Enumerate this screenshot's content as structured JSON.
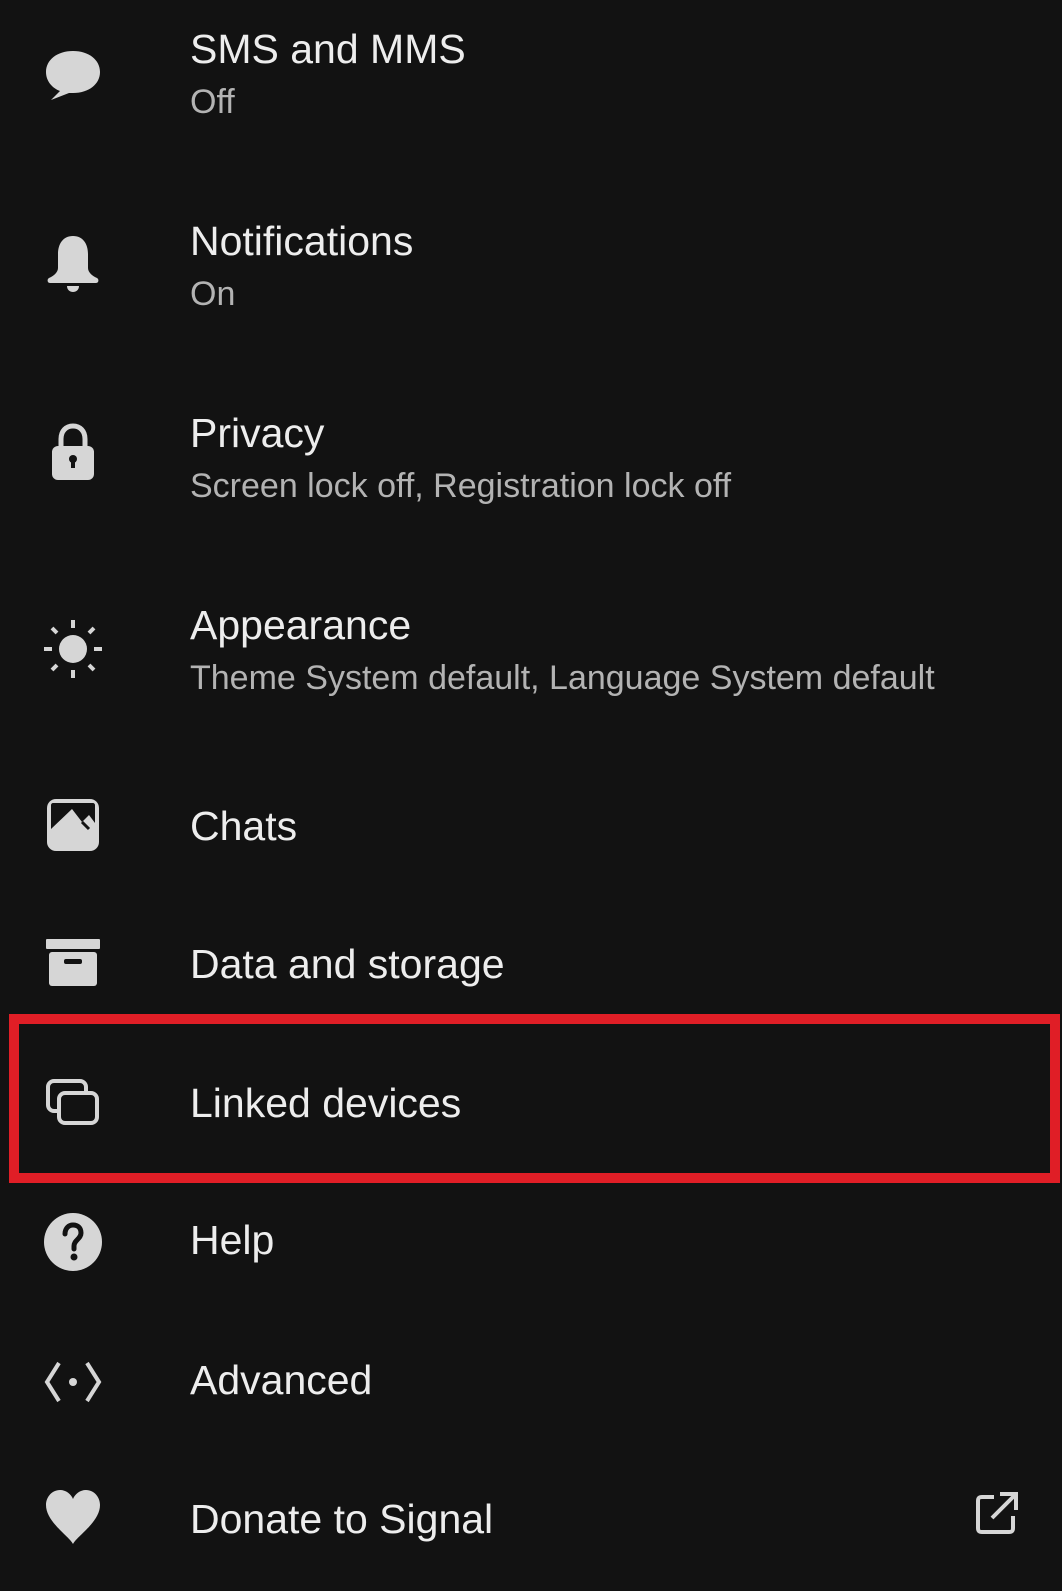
{
  "settings": {
    "items": [
      {
        "id": "sms-mms",
        "icon": "chat-bubble-icon",
        "title": "SMS and MMS",
        "subtitle": "Off"
      },
      {
        "id": "notifications",
        "icon": "bell-icon",
        "title": "Notifications",
        "subtitle": "On"
      },
      {
        "id": "privacy",
        "icon": "lock-icon",
        "title": "Privacy",
        "subtitle": "Screen lock off, Registration lock off"
      },
      {
        "id": "appearance",
        "icon": "sun-icon",
        "title": "Appearance",
        "subtitle": "Theme System default, Language System default"
      },
      {
        "id": "chats",
        "icon": "image-icon",
        "title": "Chats"
      },
      {
        "id": "data-storage",
        "icon": "archive-box-icon",
        "title": "Data and storage"
      },
      {
        "id": "linked-devices",
        "icon": "linked-devices-icon",
        "title": "Linked devices",
        "highlighted": true
      },
      {
        "id": "help",
        "icon": "help-circle-icon",
        "title": "Help"
      },
      {
        "id": "advanced",
        "icon": "code-icon",
        "title": "Advanced"
      },
      {
        "id": "donate",
        "icon": "heart-icon",
        "title": "Donate to Signal",
        "trailing_icon": "external-link-icon"
      }
    ]
  },
  "colors": {
    "background": "#121212",
    "title_text": "#ededed",
    "subtitle_text": "#b3b3b3",
    "icon": "#d6d6d6",
    "highlight_border": "#e01e26"
  }
}
